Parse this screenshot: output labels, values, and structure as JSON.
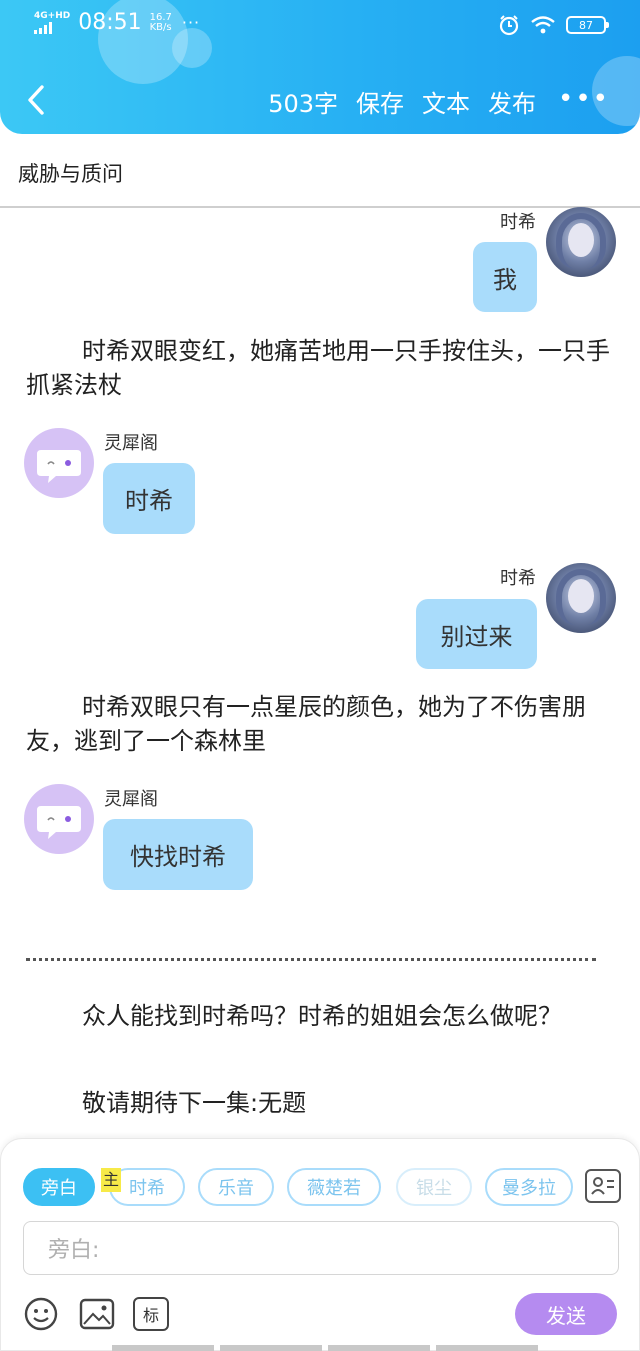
{
  "status": {
    "network": "4G+HD",
    "time": "08:51",
    "speed_value": "16.7",
    "speed_unit": "KB/s",
    "more": "···",
    "battery": "87"
  },
  "toolbar": {
    "word_count": "503字",
    "save": "保存",
    "text": "文本",
    "publish": "发布",
    "more": "•••"
  },
  "title": "威胁与质问",
  "messages": [
    {
      "speaker": "时希",
      "text": "我"
    },
    {
      "narration": "时希双眼变红，她痛苦地用一只手按住头，一只手抓紧法杖"
    },
    {
      "speaker": "灵犀阁",
      "text": "时希"
    },
    {
      "speaker": "时希",
      "text": "别过来"
    },
    {
      "narration": "时希双眼只有一点星辰的颜色，她为了不伤害朋友，逃到了一个森林里"
    },
    {
      "speaker": "灵犀阁",
      "text": "快找时希"
    },
    {
      "narration": "众人能找到时希吗？时希的姐姐会怎么做呢？"
    },
    {
      "narration": "敬请期待下一集:无题"
    }
  ],
  "composer": {
    "roles": [
      "旁白",
      "时希",
      "乐音",
      "薇楚若",
      "银尘",
      "曼多拉"
    ],
    "host_badge": "主",
    "input_placeholder": "旁白:",
    "tag_label": "标",
    "send": "发送"
  },
  "colors": {
    "header_gradient_start": "#3cc8f5",
    "header_gradient_end": "#1c9ff0",
    "bubble": "#a9dcfb",
    "send": "#b58bf0",
    "bot_avatar": "#d6c2f5"
  }
}
